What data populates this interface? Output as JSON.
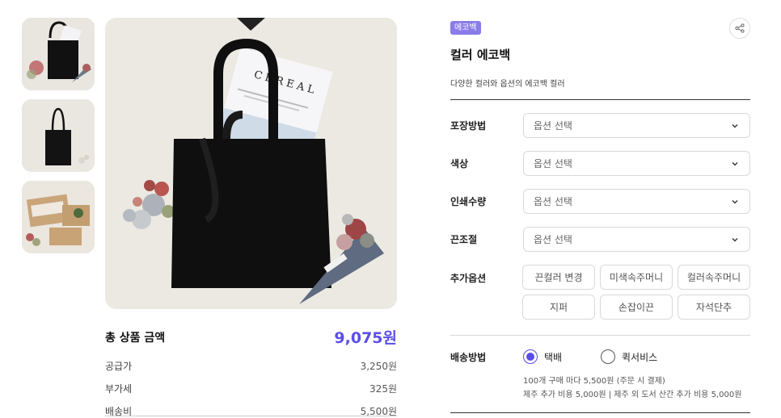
{
  "thumbnails": [
    {
      "alt": "black tote with magazine and flowers"
    },
    {
      "alt": "black tote hanging"
    },
    {
      "alt": "kraft gift box set"
    }
  ],
  "main_image": {
    "magazine_title": "CEREAL"
  },
  "price": {
    "total_label": "총 상품 금액",
    "total_value": "9,075원",
    "lines": [
      {
        "label": "공급가",
        "value": "3,250원"
      },
      {
        "label": "부가세",
        "value": "325원"
      },
      {
        "label": "배송비",
        "value": "5,500원"
      }
    ]
  },
  "product": {
    "badge": "에코백",
    "title": "컬러 에코백",
    "description": "다양한 컬러와 옵션의 에코백 컬러"
  },
  "options": [
    {
      "label": "포장방법",
      "placeholder": "옵션 선택"
    },
    {
      "label": "색상",
      "placeholder": "옵션 선택"
    },
    {
      "label": "인쇄수량",
      "placeholder": "옵션 선택"
    },
    {
      "label": "끈조절",
      "placeholder": "옵션 선택"
    }
  ],
  "addon": {
    "label": "추가옵션",
    "items": [
      "끈컬러 변경",
      "미색속주머니",
      "컬러속주머니",
      "지퍼",
      "손잡이끈",
      "자석단추"
    ]
  },
  "shipping": {
    "label": "배송방법",
    "options": [
      {
        "label": "택배",
        "selected": true
      },
      {
        "label": "퀵서비스",
        "selected": false
      }
    ],
    "note_1": "100개 구매 마다 5,500원 (주문 시 결제)",
    "note_2": "제주 추가 비용 5,000원 | 제주 외 도서 산간 추가 비용 5,000원"
  },
  "colors": {
    "accent": "#5b4ee8",
    "badge": "#8a7ce8"
  }
}
